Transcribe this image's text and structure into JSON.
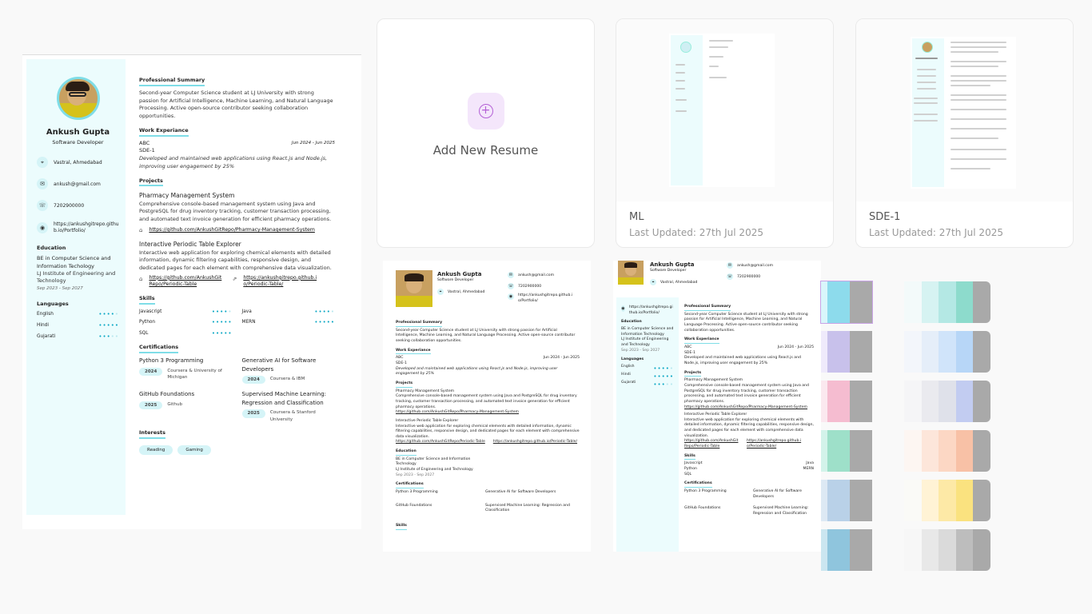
{
  "main_resume": {
    "name": "Ankush Gupta",
    "role": "Software Developer",
    "contact": {
      "location": "Vastral, Ahmedabad",
      "email": "ankush@gmail.com",
      "phone": "7202900000",
      "website": "https://ankushgitrepo.github.io/Portfolio/"
    },
    "education": {
      "heading": "Education",
      "degree": "BE in Computer Science and Information Techology",
      "institute": "LJ Institute of Engineering and Technology",
      "dates": "Sep 2023 - Sep 2027"
    },
    "languages": {
      "heading": "Languages",
      "items": [
        {
          "name": "English",
          "level": 4
        },
        {
          "name": "Hindi",
          "level": 5
        },
        {
          "name": "Gujarati",
          "level": 3
        }
      ]
    },
    "summary": {
      "heading": "Professional Summary",
      "text": "Second-year Computer Science student at LJ University with strong passion for Artificial Intelligence, Machine Learning, and Natural Language Processing. Active open-source contributor seeking collaboration opportunities."
    },
    "work": {
      "heading": "Work Experiance",
      "company": "ABC",
      "dates": "Jun 2024 - Jun 2025",
      "title": "SDE-1",
      "desc": "Developed and maintained web applications using React.js and Node.js, improving user engagement by 25%"
    },
    "projects": {
      "heading": "Projects",
      "p1_title": "Pharmacy Management System",
      "p1_desc": "Comprehensive console-based management system using Java and PostgreSQL for drug inventory tracking, customer transaction processing, and automated text invoice generation for efficient pharmacy operations.",
      "p1_link": "https://github.com/AnkushGitRepo/Pharmacy-Management-System",
      "p2_title": "Interactive Periodic Table Explorer",
      "p2_desc": "Interactive web application for exploring chemical elements with detailed information, dynamic filtering capabilities, responsive design, and dedicated pages for each element with comprehensive data visualization.",
      "p2_link1": "https://github.com/AnkushGitRepo/Periodic-Table",
      "p2_link2": "https://ankushgitrepo.github.io/Periodic-Table/"
    },
    "skills": {
      "heading": "Skills",
      "items": [
        {
          "name": "Javascript",
          "level": 4
        },
        {
          "name": "Java",
          "level": 4
        },
        {
          "name": "Python",
          "level": 5
        },
        {
          "name": "MERN",
          "level": 5
        },
        {
          "name": "SQL",
          "level": 5
        }
      ]
    },
    "certifications": {
      "heading": "Certifications",
      "items": [
        {
          "title": "Python 3 Programming",
          "year": "2024",
          "org": "Coursera & University of Michigan"
        },
        {
          "title": "Generative AI for Software Developers",
          "year": "2024",
          "org": "Coursera & IBM"
        },
        {
          "title": "GitHub Foundations",
          "year": "2025",
          "org": "Github"
        },
        {
          "title": "Supervised Machine Learning: Regression and Classification",
          "year": "2025",
          "org": "Coursera & Stanford University"
        }
      ]
    },
    "interests": {
      "heading": "Interests",
      "items": [
        "Reading",
        "Gaming"
      ]
    }
  },
  "cards": {
    "add_label": "Add New Resume",
    "ml": {
      "title": "ML",
      "date": "Last Updated: 27th Jul 2025"
    },
    "sde": {
      "title": "SDE-1",
      "date": "Last Updated: 27th Jul 2025"
    }
  },
  "templates": {
    "left": {
      "education_degree": "BE in Computer Science and Information Technology",
      "education_inst": "LJ Institute of Engineering and Technology",
      "education_dates": "Sep 2023 - Sep 2027",
      "skills_heading": "Skills"
    },
    "right": {
      "website_short": "https://ankushgitrepo.github.io/Portfolio/",
      "education_degree": "BE in Computer Science and Information Technology",
      "education_inst": "LJ Institute of Engineering and Technology",
      "skills_heading": "Skills",
      "skill_items": [
        "Javascript",
        "Java",
        "Python",
        "MERN",
        "SQL"
      ]
    }
  },
  "palettes": [
    {
      "left": [
        "#d9f6fb",
        "#8ddbec",
        "#a9a9a9"
      ],
      "right": [
        "#f3fafa",
        "#d6f3f2",
        "#b4e8e4",
        "#8ddbcc",
        "#a9a9a9"
      ],
      "highlight": true
    },
    {
      "left": [
        "#efeafb",
        "#c8c1eb",
        "#a9a9a9"
      ],
      "right": [
        "#f3f6fb",
        "#e5eef9",
        "#d0e4fa",
        "#b7d6f7",
        "#a9a9a9"
      ]
    },
    {
      "left": [
        "#fbe8ef",
        "#f5bcd0",
        "#a9a9a9"
      ],
      "right": [
        "#f5f5f7",
        "#eaeaef",
        "#dfe1ea",
        "#c2ccf1",
        "#a9a9a9"
      ]
    },
    {
      "left": [
        "#d3f3ea",
        "#9ee0c9",
        "#a9a9a9"
      ],
      "right": [
        "#fdf6f2",
        "#fde6da",
        "#fcd7c4",
        "#f8c1a6",
        "#a9a9a9"
      ]
    },
    {
      "left": [
        "#dde9f4",
        "#b9d1e8",
        "#a9a9a9"
      ],
      "right": [
        "#fafaf7",
        "#fff3d5",
        "#fde9a6",
        "#fae27f",
        "#a9a9a9"
      ]
    },
    {
      "left": [
        "#cbe6f0",
        "#8fc5dd",
        "#a9a9a9"
      ],
      "right": [
        "#f7f7f7",
        "#e8e8e8",
        "#dadada",
        "#bdbdbd",
        "#a9a9a9"
      ]
    }
  ]
}
